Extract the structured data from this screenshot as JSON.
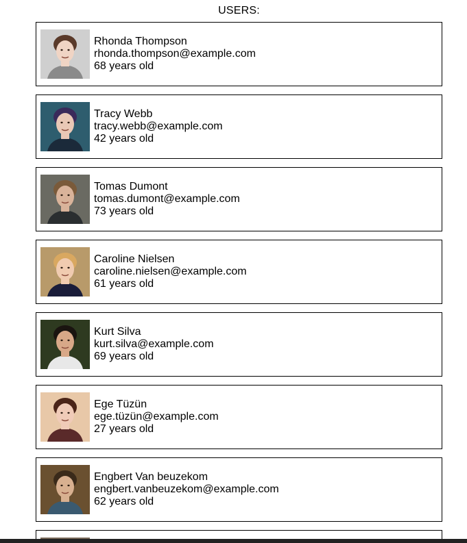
{
  "page": {
    "title": "USERS:"
  },
  "users": [
    {
      "name": "Rhonda Thompson",
      "email": "rhonda.thompson@example.com",
      "age": "68 years old",
      "avatar": {
        "bg": "#cfcfcf",
        "skin": "#f0d4c4",
        "hair": "#5a3a2a",
        "shirt": "#8a8a8a"
      }
    },
    {
      "name": "Tracy Webb",
      "email": "tracy.webb@example.com",
      "age": "42 years old",
      "avatar": {
        "bg": "#2e5d6e",
        "skin": "#e9c8b6",
        "hair": "#3a2a5a",
        "shirt": "#1b2a3a"
      }
    },
    {
      "name": "Tomas Dumont",
      "email": "tomas.dumont@example.com",
      "age": "73 years old",
      "avatar": {
        "bg": "#6a6a62",
        "skin": "#d9b39a",
        "hair": "#7a5a3a",
        "shirt": "#2a2e30"
      }
    },
    {
      "name": "Caroline Nielsen",
      "email": "caroline.nielsen@example.com",
      "age": "61 years old",
      "avatar": {
        "bg": "#b89a6a",
        "skin": "#f0cbb0",
        "hair": "#d9a860",
        "shirt": "#1a1d3a"
      }
    },
    {
      "name": "Kurt Silva",
      "email": "kurt.silva@example.com",
      "age": "69 years old",
      "avatar": {
        "bg": "#2e3a20",
        "skin": "#d8a888",
        "hair": "#1a1410",
        "shirt": "#e8e8e8"
      }
    },
    {
      "name": "Ege Tüzün",
      "email": "ege.tüzün@example.com",
      "age": "27 years old",
      "avatar": {
        "bg": "#e8c8a8",
        "skin": "#f0cbb8",
        "hair": "#4a2418",
        "shirt": "#5a2a2a"
      }
    },
    {
      "name": "Engbert Van beuzekom",
      "email": "engbert.vanbeuzekom@example.com",
      "age": "62 years old",
      "avatar": {
        "bg": "#6a5030",
        "skin": "#d8b090",
        "hair": "#3a2a1a",
        "shirt": "#3a5a70"
      }
    }
  ]
}
